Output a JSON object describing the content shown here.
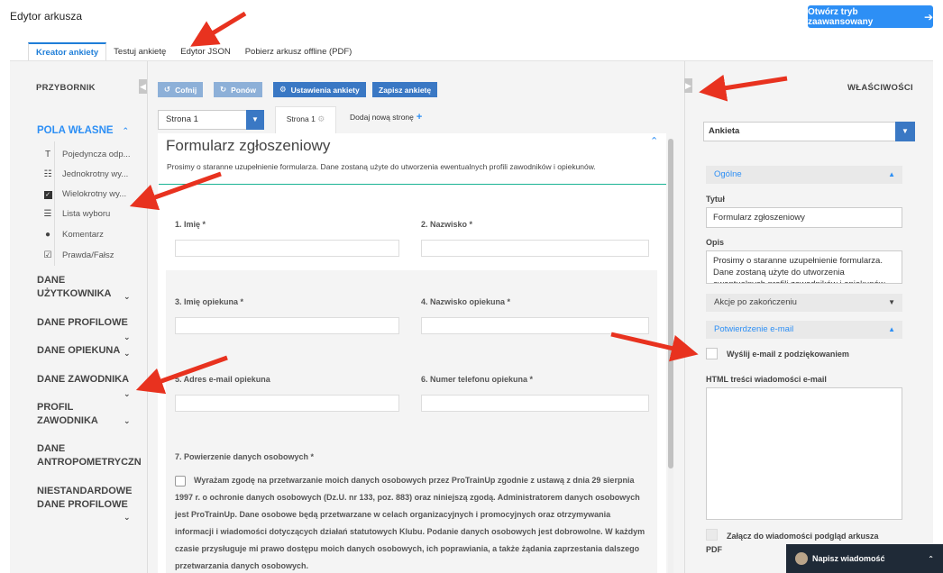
{
  "app": {
    "title": "Edytor arkusza",
    "advanced_button": "Otwórz tryb zaawansowany"
  },
  "tabs": [
    "Kreator ankiety",
    "Testuj ankietę",
    "Edytor JSON",
    "Pobierz arkusz offline (PDF)"
  ],
  "toolbox": {
    "title": "PRZYBORNIK",
    "group": "POLA WŁASNE",
    "items": [
      {
        "icon": "text-icon",
        "label": "Pojedyncza odp..."
      },
      {
        "icon": "radio-list-icon",
        "label": "Jednokrotny wy..."
      },
      {
        "icon": "checkbox-icon",
        "label": "Wielokrotny wy..."
      },
      {
        "icon": "dropdown-icon",
        "label": "Lista wyboru"
      },
      {
        "icon": "comment-icon",
        "label": "Komentarz"
      },
      {
        "icon": "boolean-icon",
        "label": "Prawda/Fałsz"
      }
    ],
    "categories": [
      "DANE UŻYTKOWNIKA",
      "DANE PROFILOWE",
      "DANE OPIEKUNA",
      "DANE ZAWODNIKA",
      "PROFIL ZAWODNIKA",
      "DANE ANTROPOMETRYCZN",
      "NIESTANDARDOWE DANE PROFILOWE"
    ]
  },
  "toolbar": {
    "undo": "Cofnij",
    "redo": "Ponów",
    "settings": "Ustawienia ankiety",
    "save": "Zapisz ankietę"
  },
  "pages": {
    "selected": "Strona 1",
    "tab": "Strona 1",
    "add": "Dodaj nową stronę"
  },
  "form": {
    "title": "Formularz zgłoszeniowy",
    "description": "Prosimy o staranne uzupełnienie formularza. Dane zostaną użyte do utworzenia ewentualnych profili zawodników i opiekunów.",
    "questions": [
      "1. Imię *",
      "2. Nazwisko *",
      "3. Imię opiekuna *",
      "4. Nazwisko opiekuna *",
      "5. Adres e-mail opiekuna",
      "6. Numer telefonu opiekuna *"
    ],
    "q7_title": "7. Powierzenie danych osobowych *",
    "q7_text": "Wyrażam zgodę na przetwarzanie moich danych osobowych przez ProTrainUp zgodnie z ustawą z dnia 29 sierpnia 1997 r. o ochronie danych osobowych (Dz.U. nr 133, poz. 883) oraz niniejszą zgodą. Administratorem danych osobowych jest ProTrainUp. Dane osobowe będą przetwarzane w celach organizacyjnych i promocyjnych oraz otrzymywania informacji i wiadomości dotyczących działań statutowych Klubu. Podanie danych osobowych jest dobrowolne. W każdym czasie przysługuje mi prawo dostępu moich danych osobowych, ich poprawiania, a także żądania zaprzestania dalszego przetwarzania danych osobowych."
  },
  "props": {
    "title": "WŁAŚCIWOŚCI",
    "selected_object": "Ankieta",
    "sections": {
      "general": "Ogólne",
      "after_complete": "Akcje po zakończeniu",
      "email": "Potwierdzenie e-mail"
    },
    "title_label": "Tytuł",
    "title_value": "Formularz zgłoszeniowy",
    "desc_label": "Opis",
    "desc_value": "Prosimy o staranne uzupełnienie formularza. Dane zostaną użyte do utworzenia ewentualnych profili zawodników i opiekunów.",
    "send_email": "Wyślij e-mail z podziękowaniem",
    "html_label": "HTML treści wiadomości e-mail",
    "attach_line1": "Załącz do wiadomości podgląd arkusza",
    "attach_line2": "PDF"
  },
  "chat": {
    "label": "Napisz wiadomość"
  },
  "colors": {
    "accent": "#2d8ff5",
    "button_dark": "#3a78c4",
    "button_light": "#8db0d8",
    "arrow": "#e8321f",
    "chat_bg": "#1f2a37"
  }
}
